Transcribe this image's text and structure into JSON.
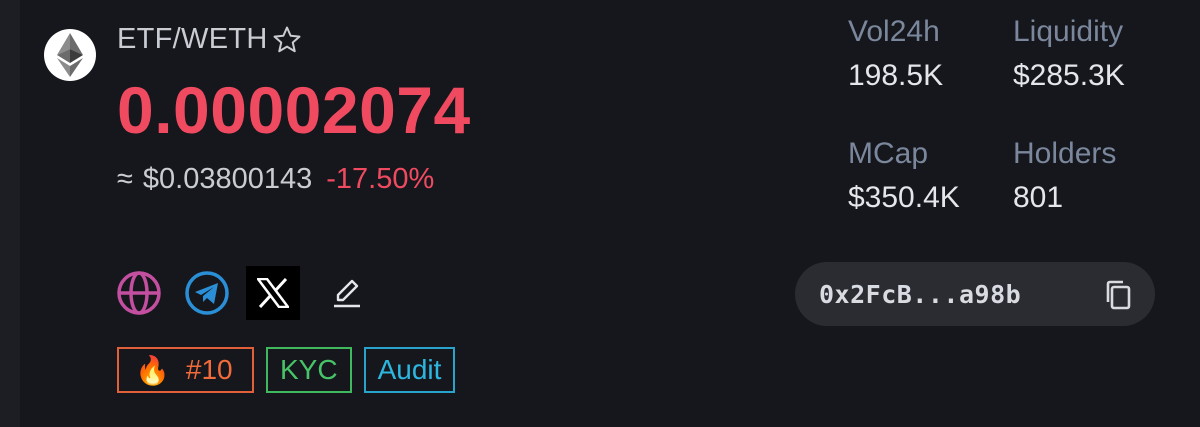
{
  "token": {
    "pair": "ETF/WETH",
    "price": "0.00002074",
    "usd_prefix": "≈",
    "usd_price": "$0.03800143",
    "change": "-17.50%",
    "logo_icon": "ethereum-icon",
    "favorite_icon": "star-outline-icon"
  },
  "stats": {
    "vol24h_label": "Vol24h",
    "vol24h_value": "198.5K",
    "liquidity_label": "Liquidity",
    "liquidity_value": "$285.3K",
    "mcap_label": "MCap",
    "mcap_value": "$350.4K",
    "holders_label": "Holders",
    "holders_value": "801"
  },
  "socials": [
    {
      "name": "website",
      "icon": "globe-icon"
    },
    {
      "name": "telegram",
      "icon": "telegram-icon"
    },
    {
      "name": "x",
      "icon": "x-logo-icon"
    },
    {
      "name": "edit",
      "icon": "edit-pencil-icon"
    }
  ],
  "badges": {
    "rank_icon": "fire-emoji",
    "rank": "#10",
    "kyc": "KYC",
    "audit": "Audit"
  },
  "address": {
    "short": "0x2FcB...a98b",
    "copy_icon": "copy-icon"
  },
  "colors": {
    "background": "#16171c",
    "negative": "#f04a61",
    "kyc_green": "#47c467",
    "audit_blue": "#2db6e0",
    "rank_orange": "#f26b3a",
    "globe_magenta": "#c34fa0",
    "telegram_blue": "#2a8fd6"
  }
}
